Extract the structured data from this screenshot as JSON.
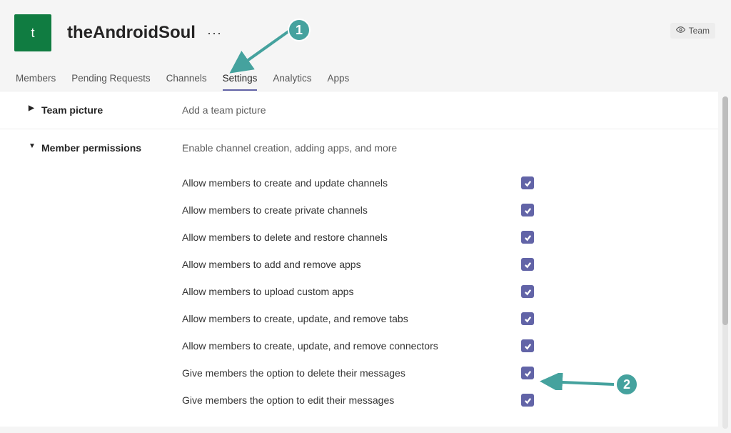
{
  "header": {
    "avatar_letter": "t",
    "title": "theAndroidSoul",
    "more": "···",
    "team_badge": "Team"
  },
  "tabs": [
    {
      "label": "Members",
      "active": false
    },
    {
      "label": "Pending Requests",
      "active": false
    },
    {
      "label": "Channels",
      "active": false
    },
    {
      "label": "Settings",
      "active": true
    },
    {
      "label": "Analytics",
      "active": false
    },
    {
      "label": "Apps",
      "active": false
    }
  ],
  "sections": {
    "team_picture": {
      "title": "Team picture",
      "desc": "Add a team picture"
    },
    "member_permissions": {
      "title": "Member permissions",
      "desc": "Enable channel creation, adding apps, and more",
      "items": [
        {
          "label": "Allow members to create and update channels",
          "checked": true
        },
        {
          "label": "Allow members to create private channels",
          "checked": true
        },
        {
          "label": "Allow members to delete and restore channels",
          "checked": true
        },
        {
          "label": "Allow members to add and remove apps",
          "checked": true
        },
        {
          "label": "Allow members to upload custom apps",
          "checked": true
        },
        {
          "label": "Allow members to create, update, and remove tabs",
          "checked": true
        },
        {
          "label": "Allow members to create, update, and remove connectors",
          "checked": true
        },
        {
          "label": "Give members the option to delete their messages",
          "checked": true
        },
        {
          "label": "Give members the option to edit their messages",
          "checked": true
        }
      ]
    }
  },
  "annotations": {
    "step1": "1",
    "step2": "2"
  }
}
